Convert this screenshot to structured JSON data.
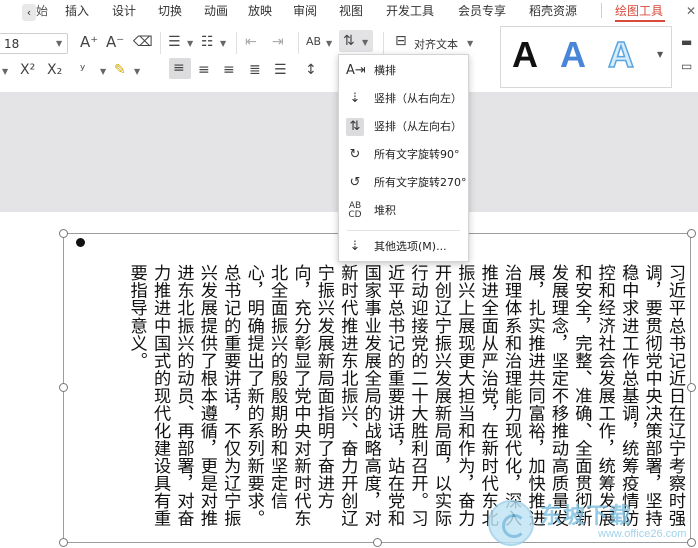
{
  "tabs": {
    "partial_first": "始",
    "items": [
      "插入",
      "设计",
      "切换",
      "动画",
      "放映",
      "审阅",
      "视图",
      "开发工具",
      "会员专享",
      "稻壳资源"
    ],
    "context_tab": "绘图工具",
    "active_color": "#d94a3c"
  },
  "ribbon": {
    "font_size": "18",
    "orientation_button": "text-direction-icon",
    "align_text_label": "对齐文本",
    "style_samples": [
      {
        "glyph": "A",
        "color": "#111111"
      },
      {
        "glyph": "A",
        "color": "#4a86d8"
      },
      {
        "glyph": "A",
        "color": "#8cc2ec"
      }
    ]
  },
  "menu": {
    "items": [
      {
        "icon": "horizontal-text-icon",
        "label": "横排"
      },
      {
        "icon": "vertical-rtl-text-icon",
        "label": "竖排（从右向左）"
      },
      {
        "icon": "vertical-ltr-text-icon",
        "label": "竖排（从左向右）"
      },
      {
        "icon": "rotate-90-text-icon",
        "label": "所有文字旋转90°"
      },
      {
        "icon": "rotate-270-text-icon",
        "label": "所有文字旋转270°"
      },
      {
        "icon": "stacked-text-icon",
        "label": "堆积"
      },
      {
        "icon": "more-options-icon",
        "label": "其他选项(M)..."
      }
    ]
  },
  "document": {
    "body_text": "习近平总书记近日在辽宁考察时强调，要贯彻党中央决策部署，坚持稳中求进工作总基调，统筹疫情防控和经济社会发展工作，统筹发展和安全，完整、准确、全面贯彻新发展理念，坚定不移推动高质量发展，扎实推进共同富裕，加快推进治理体系和治理能力现代化，深入推进全面从严治党，在新时代东北振兴上展现更大担当和作为，奋力开创辽宁振兴发展新局面，以实际行动迎接党的二十大胜利召开。习近平总书记的重要讲话，站在党和国家事业发展全局的战略高度，对新时代推进东北振兴、奋力开创辽宁振兴发展新局面指明了奋进方向，充分彰显了党中央对新时代东北全面振兴的殷殷期盼和坚定信心，明确提出了新的系列新要求。总书记的重要讲话，不仅为辽宁振兴发展提供了根本遵循，更是对推进东北振兴的动员、再部署，对奋力推进中国式的现代化建设具有重要指导意义。"
  },
  "watermark": {
    "title": "东坡下载",
    "subtitle": "www.office26.com"
  }
}
